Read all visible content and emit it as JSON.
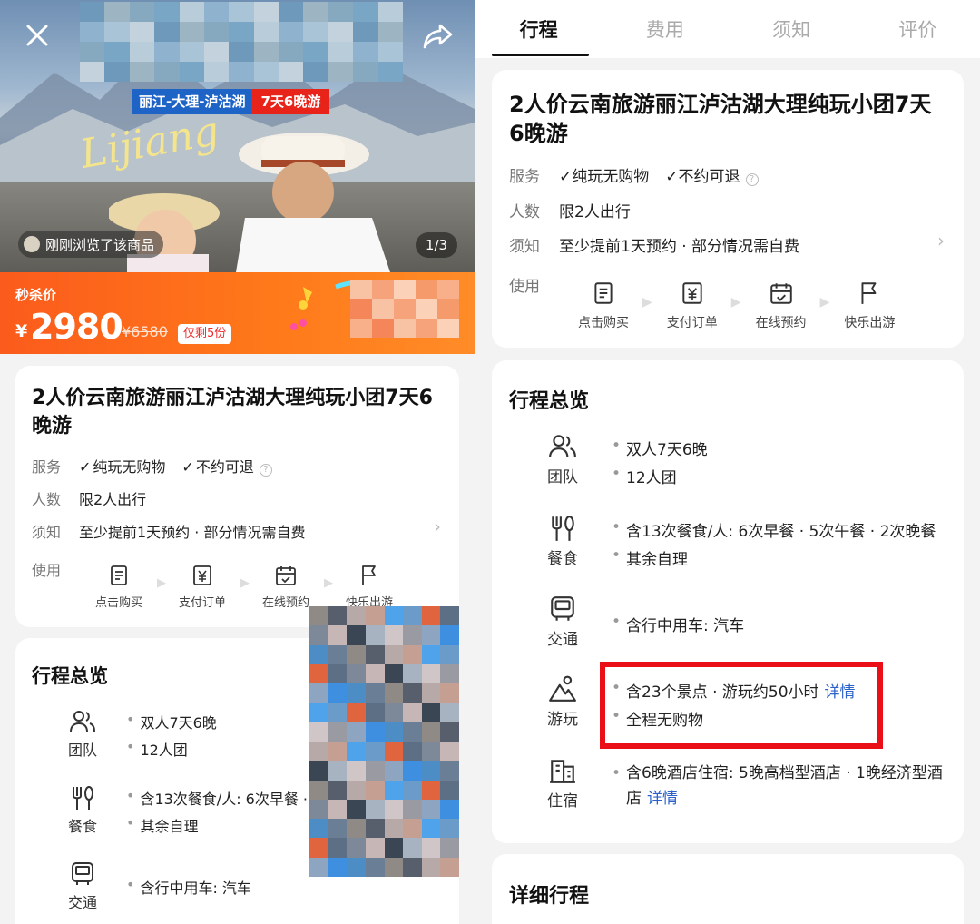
{
  "product": {
    "title": "2人价云南旅游丽江泸沽湖大理纯玩小团7天6晚游",
    "service_label": "服务",
    "service_values": [
      "纯玩无购物",
      "不约可退"
    ],
    "people_label": "人数",
    "people_value": "限2人出行",
    "notice_label": "须知",
    "notice_value": "至少提前1天预约 · 部分情况需自费",
    "usage_label": "使用",
    "usage_steps": [
      {
        "label": "点击购买",
        "icon": "receipt-icon"
      },
      {
        "label": "支付订单",
        "icon": "yen-payment-icon"
      },
      {
        "label": "在线预约",
        "icon": "calendar-check-icon"
      },
      {
        "label": "快乐出游",
        "icon": "flag-icon"
      }
    ]
  },
  "hero": {
    "route_tag": "丽江-大理-泸沽湖",
    "days_tag": "7天6晚游",
    "script_text": "Lijiang",
    "viewed_text": "刚刚浏览了该商品",
    "pager": "1/3"
  },
  "price": {
    "flash_label": "秒杀价",
    "currency": "¥",
    "current": "2980",
    "original": "¥6580",
    "stock_badge": "仅剩5份"
  },
  "tabs": [
    "行程",
    "费用",
    "须知",
    "评价"
  ],
  "overview": {
    "title": "行程总览",
    "rows": [
      {
        "icon": "group-icon",
        "label": "团队",
        "items": [
          {
            "text": "双人7天6晚"
          },
          {
            "text": "12人团"
          }
        ]
      },
      {
        "icon": "dining-icon",
        "label": "餐食",
        "items": [
          {
            "text": "含13次餐食/人: 6次早餐 · 5次午餐 · 2次晚餐"
          },
          {
            "text": "其余自理"
          }
        ]
      },
      {
        "icon": "bus-icon",
        "label": "交通",
        "items": [
          {
            "text": "含行中用车: 汽车"
          }
        ]
      },
      {
        "icon": "sightseeing-icon",
        "label": "游玩",
        "items": [
          {
            "text": "含23个景点 · 游玩约50小时",
            "link": "详情"
          },
          {
            "text": "全程无购物"
          }
        ]
      },
      {
        "icon": "hotel-icon",
        "label": "住宿",
        "items": [
          {
            "text": "含6晚酒店住宿: 5晚高档型酒店 · 1晚经济型酒店",
            "link": "详情"
          }
        ]
      }
    ],
    "left_meal_text": "含13次餐食/人: 6次早餐 ·"
  },
  "detail": {
    "title": "详细行程"
  },
  "colors": {
    "accent_orange": "#fb5b1c",
    "highlight_red": "#ea0f17",
    "link_blue": "#2a62c9",
    "route_blue": "#1e63c6",
    "days_red": "#e8231a"
  }
}
